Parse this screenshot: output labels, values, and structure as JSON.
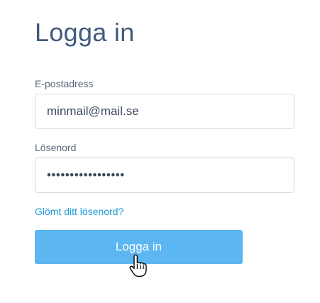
{
  "login": {
    "title": "Logga in",
    "email_label": "E-postadress",
    "email_value": "minmail@mail.se",
    "password_label": "Lösenord",
    "password_value": "•••••••••••••••••",
    "forgot_link": "Glömt ditt lösenord?",
    "submit_label": "Logga in"
  },
  "cursor": {
    "icon": "hand-pointer-icon"
  },
  "colors": {
    "title": "#415a7d",
    "link": "#1e9ad6",
    "button_bg": "#5bb6f2",
    "button_text": "#ffffff",
    "input_border": "#d6dbe1"
  }
}
